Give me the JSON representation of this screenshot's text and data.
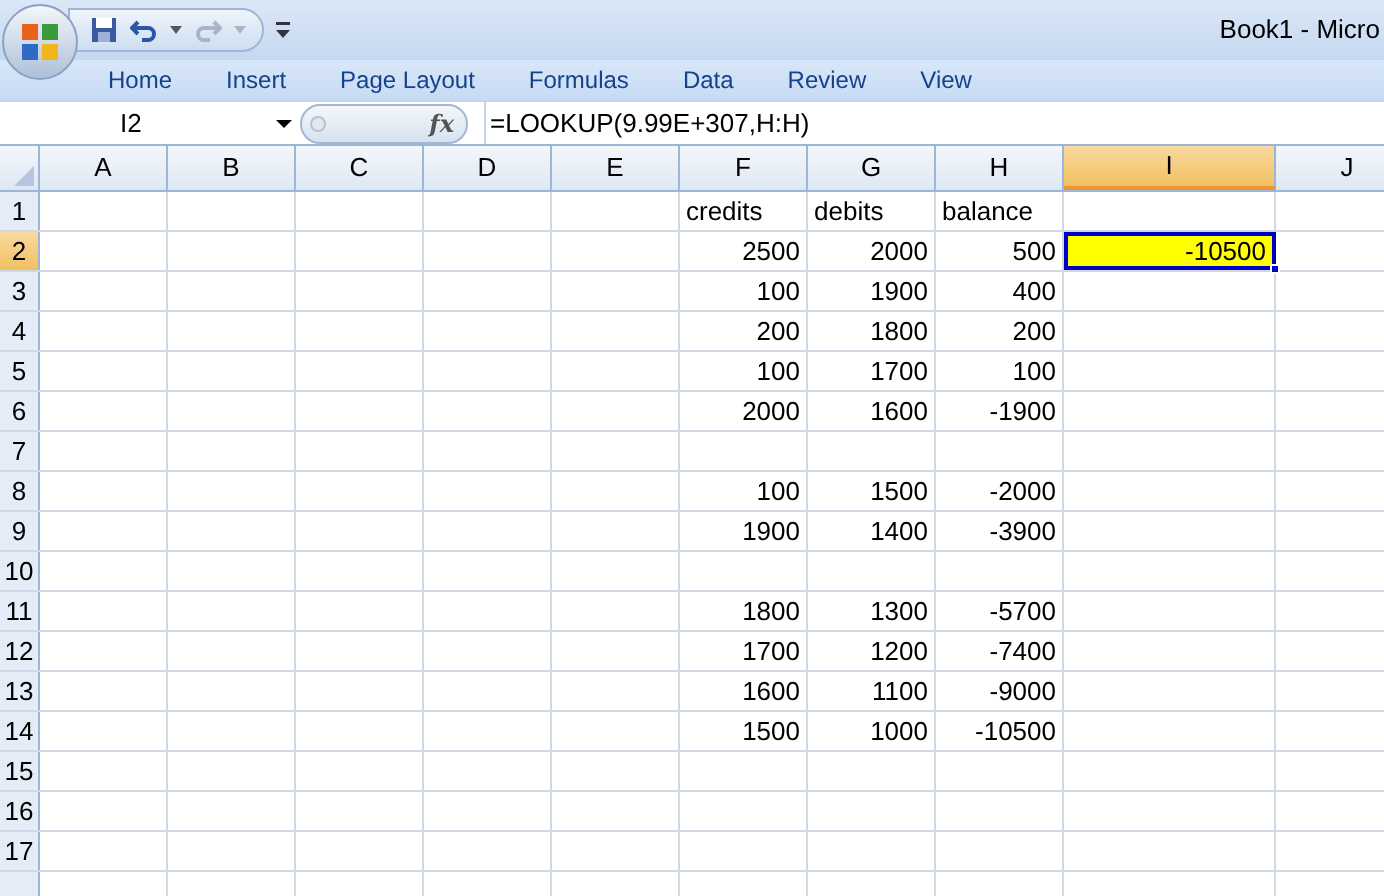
{
  "window": {
    "title": "Book1 - Micro"
  },
  "ribbon_tabs": [
    {
      "label": "Home"
    },
    {
      "label": "Insert"
    },
    {
      "label": "Page Layout"
    },
    {
      "label": "Formulas"
    },
    {
      "label": "Data"
    },
    {
      "label": "Review"
    },
    {
      "label": "View"
    }
  ],
  "formula_bar": {
    "name_box": "I2",
    "function_label": "fx",
    "formula": "=LOOKUP(9.99E+307,H:H)"
  },
  "columns": [
    {
      "label": "A",
      "selected": false
    },
    {
      "label": "B",
      "selected": false
    },
    {
      "label": "C",
      "selected": false
    },
    {
      "label": "D",
      "selected": false
    },
    {
      "label": "E",
      "selected": false
    },
    {
      "label": "F",
      "selected": false
    },
    {
      "label": "G",
      "selected": false
    },
    {
      "label": "H",
      "selected": false
    },
    {
      "label": "I",
      "selected": true
    },
    {
      "label": "J",
      "selected": false
    }
  ],
  "rows": [
    {
      "label": "1",
      "selected": false,
      "cells": {
        "F": {
          "kind": "text",
          "value": "credits",
          "selected": false
        },
        "G": {
          "kind": "text",
          "value": "debits",
          "selected": false
        },
        "H": {
          "kind": "text",
          "value": "balance",
          "selected": false
        }
      }
    },
    {
      "label": "2",
      "selected": true,
      "cells": {
        "F": {
          "kind": "number",
          "value": "2500",
          "selected": false
        },
        "G": {
          "kind": "number",
          "value": "2000",
          "selected": false
        },
        "H": {
          "kind": "number",
          "value": "500",
          "selected": false
        },
        "I": {
          "kind": "number",
          "value": "-10500",
          "selected": true
        }
      }
    },
    {
      "label": "3",
      "selected": false,
      "cells": {
        "F": {
          "kind": "number",
          "value": "100",
          "selected": false
        },
        "G": {
          "kind": "number",
          "value": "1900",
          "selected": false
        },
        "H": {
          "kind": "number",
          "value": "400",
          "selected": false
        }
      }
    },
    {
      "label": "4",
      "selected": false,
      "cells": {
        "F": {
          "kind": "number",
          "value": "200",
          "selected": false
        },
        "G": {
          "kind": "number",
          "value": "1800",
          "selected": false
        },
        "H": {
          "kind": "number",
          "value": "200",
          "selected": false
        }
      }
    },
    {
      "label": "5",
      "selected": false,
      "cells": {
        "F": {
          "kind": "number",
          "value": "100",
          "selected": false
        },
        "G": {
          "kind": "number",
          "value": "1700",
          "selected": false
        },
        "H": {
          "kind": "number",
          "value": "100",
          "selected": false
        }
      }
    },
    {
      "label": "6",
      "selected": false,
      "cells": {
        "F": {
          "kind": "number",
          "value": "2000",
          "selected": false
        },
        "G": {
          "kind": "number",
          "value": "1600",
          "selected": false
        },
        "H": {
          "kind": "number",
          "value": "-1900",
          "selected": false
        }
      }
    },
    {
      "label": "7",
      "selected": false
    },
    {
      "label": "8",
      "selected": false,
      "cells": {
        "F": {
          "kind": "number",
          "value": "100",
          "selected": false
        },
        "G": {
          "kind": "number",
          "value": "1500",
          "selected": false
        },
        "H": {
          "kind": "number",
          "value": "-2000",
          "selected": false
        }
      }
    },
    {
      "label": "9",
      "selected": false,
      "cells": {
        "F": {
          "kind": "number",
          "value": "1900",
          "selected": false
        },
        "G": {
          "kind": "number",
          "value": "1400",
          "selected": false
        },
        "H": {
          "kind": "number",
          "value": "-3900",
          "selected": false
        }
      }
    },
    {
      "label": "10",
      "selected": false
    },
    {
      "label": "11",
      "selected": false,
      "cells": {
        "F": {
          "kind": "number",
          "value": "1800",
          "selected": false
        },
        "G": {
          "kind": "number",
          "value": "1300",
          "selected": false
        },
        "H": {
          "kind": "number",
          "value": "-5700",
          "selected": false
        }
      }
    },
    {
      "label": "12",
      "selected": false,
      "cells": {
        "F": {
          "kind": "number",
          "value": "1700",
          "selected": false
        },
        "G": {
          "kind": "number",
          "value": "1200",
          "selected": false
        },
        "H": {
          "kind": "number",
          "value": "-7400",
          "selected": false
        }
      }
    },
    {
      "label": "13",
      "selected": false,
      "cells": {
        "F": {
          "kind": "number",
          "value": "1600",
          "selected": false
        },
        "G": {
          "kind": "number",
          "value": "1100",
          "selected": false
        },
        "H": {
          "kind": "number",
          "value": "-9000",
          "selected": false
        }
      }
    },
    {
      "label": "14",
      "selected": false,
      "cells": {
        "F": {
          "kind": "number",
          "value": "1500",
          "selected": false
        },
        "G": {
          "kind": "number",
          "value": "1000",
          "selected": false
        },
        "H": {
          "kind": "number",
          "value": "-10500",
          "selected": false
        }
      }
    },
    {
      "label": "15",
      "selected": false
    },
    {
      "label": "16",
      "selected": false
    },
    {
      "label": "17",
      "selected": false
    }
  ]
}
